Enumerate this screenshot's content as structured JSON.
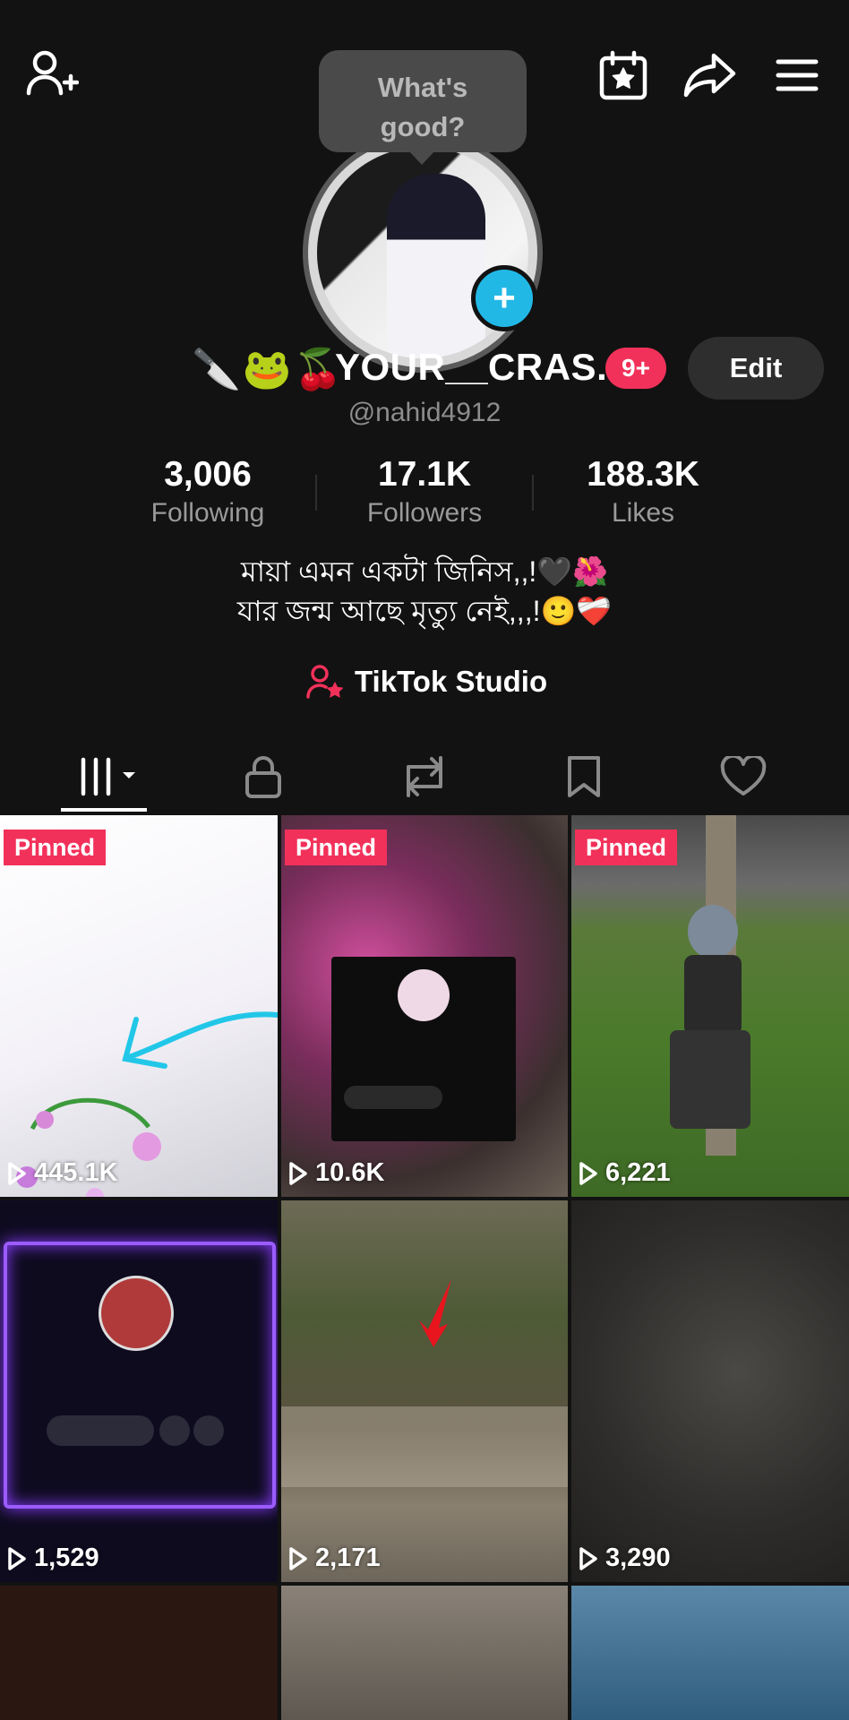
{
  "bubble": {
    "text": "What's good?"
  },
  "profile": {
    "name_emoji": "🔪🐸🍒",
    "name": "YOUR__CRAS...",
    "notification_badge": "9+",
    "edit_label": "Edit",
    "handle": "@nahid4912"
  },
  "stats": [
    {
      "value": "3,006",
      "label": "Following"
    },
    {
      "value": "17.1K",
      "label": "Followers"
    },
    {
      "value": "188.3K",
      "label": "Likes"
    }
  ],
  "bio": {
    "line1": "মায়া এমন একটা জিনিস,,!🖤🌺",
    "line2": "যার জন্ম আছে মৃত্যু নেই,,,!🙂❤️‍🩹"
  },
  "studio": {
    "label": "TikTok Studio"
  },
  "tabs": [
    {
      "icon": "videos-grid-icon",
      "active": true
    },
    {
      "icon": "lock-icon"
    },
    {
      "icon": "repost-icon"
    },
    {
      "icon": "bookmark-icon"
    },
    {
      "icon": "heart-icon"
    }
  ],
  "videos": [
    {
      "pinned": "Pinned",
      "views": "445.1K"
    },
    {
      "pinned": "Pinned",
      "views": "10.6K"
    },
    {
      "pinned": "Pinned",
      "views": "6,221"
    },
    {
      "pinned": "",
      "views": "1,529"
    },
    {
      "pinned": "",
      "views": "2,171"
    },
    {
      "pinned": "",
      "views": "3,290"
    }
  ],
  "colors": {
    "accent": "#f2315a",
    "plus": "#22b8e6",
    "background": "#121212"
  }
}
